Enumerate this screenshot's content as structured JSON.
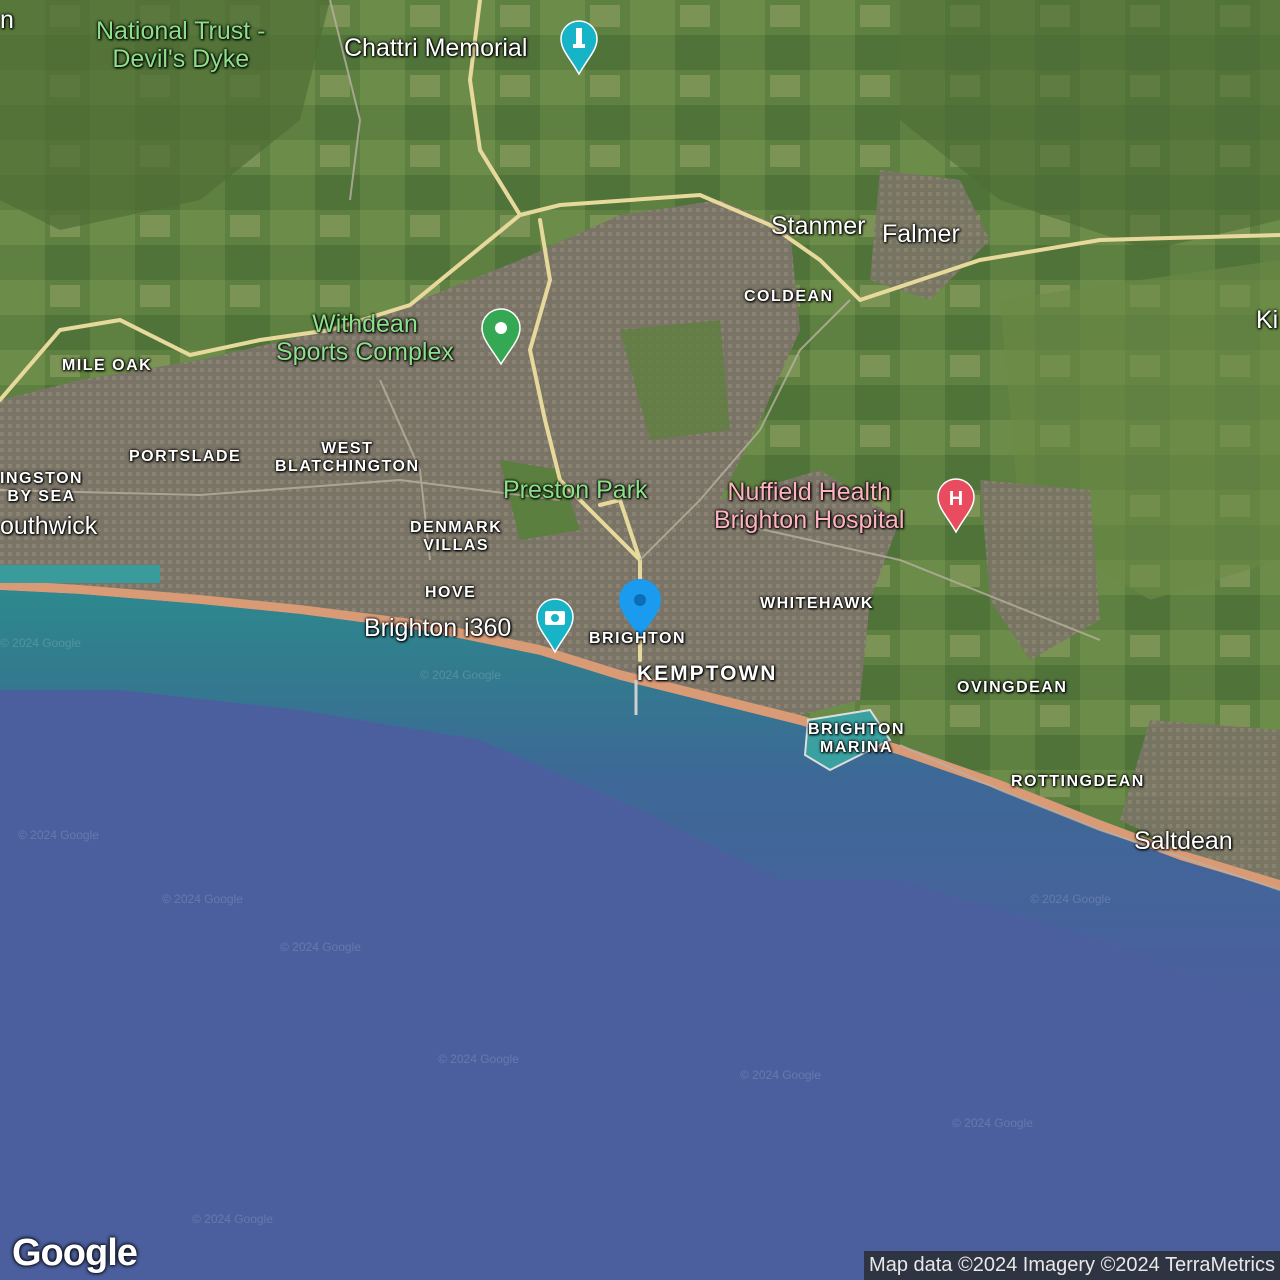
{
  "colors": {
    "sea_deep": "#4b5f9e",
    "sea_shallow": "#2b8a8c",
    "land_green": "#5d7f3c",
    "urban": "#7b7568",
    "road": "#e6d99b",
    "poi_green": "#34a853",
    "poi_teal": "#17b3c7",
    "poi_red": "#ea4c5f",
    "marker_blue": "#1a9bf0"
  },
  "places": {
    "edge_n": "n",
    "national_trust": "National Trust -\nDevil's Dyke",
    "chattri": "Chattri Memorial",
    "stanmer": "Stanmer",
    "falmer": "Falmer",
    "coldean": "COLDEAN",
    "edge_ki": "Ki",
    "mile_oak": "MILE OAK",
    "withdean": "Withdean\nSports Complex",
    "portslade": "PORTSLADE",
    "west_blatchington": "WEST\nBLATCHINGTON",
    "shoreham": "INGSTON\nBY SEA",
    "southwick": "outhwick",
    "preston_park": "Preston Park",
    "nuffield": "Nuffield Health\nBrighton Hospital",
    "denmark_villas": "DENMARK\nVILLAS",
    "hove": "HOVE",
    "whitehawk": "WHITEHAWK",
    "brighton_i360": "Brighton i360",
    "brighton": "BRIGHTON",
    "kemptown": "KEMPTOWN",
    "ovingdean": "OVINGDEAN",
    "brighton_marina": "BRIGHTON\nMARINA",
    "rottingdean": "ROTTINGDEAN",
    "saltdean": "Saltdean"
  },
  "icons": {
    "poi_park": "park-pin-icon",
    "poi_monument": "monument-pin-icon",
    "poi_attraction": "camera-pin-icon",
    "poi_hospital": "hospital-pin-icon",
    "selected": "location-marker-icon"
  },
  "watermark": "© 2024 Google",
  "logo": "Google",
  "attribution": "Map data ©2024 Imagery ©2024 TerraMetrics"
}
